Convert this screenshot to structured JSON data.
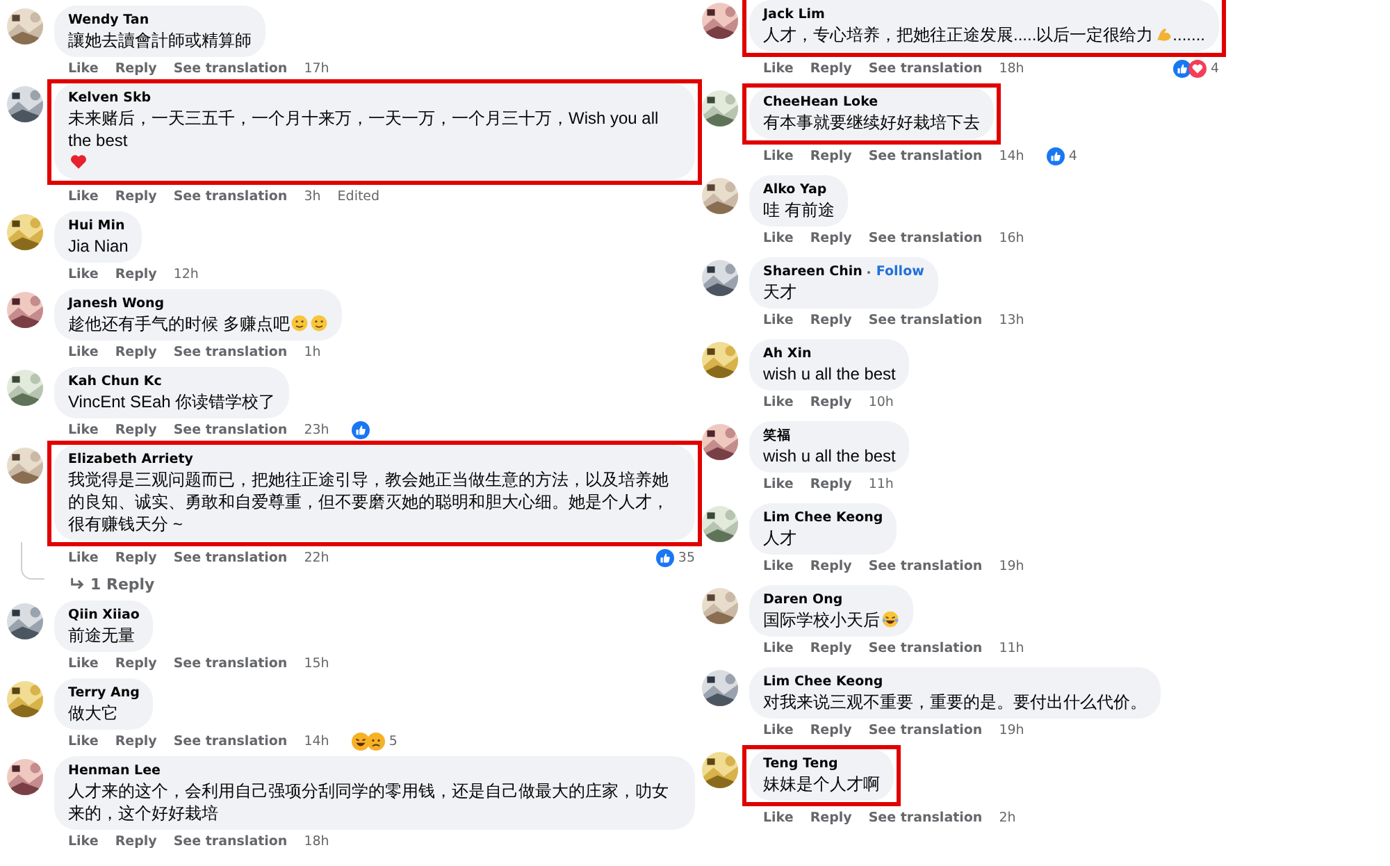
{
  "columns": [
    {
      "comments": [
        {
          "name": "Wendy Tan",
          "highlighted": false,
          "body": [
            {
              "kind": "text",
              "text": "讓她去讀會計師或精算師"
            }
          ],
          "actions": [
            "Like",
            "Reply",
            "See translation"
          ],
          "time": "17h"
        },
        {
          "name": "Kelven Skb",
          "highlighted": true,
          "body": [
            {
              "kind": "text",
              "text": "未来赌后，一天三五千，一个月十来万，一天一万，一个月三十万，Wish you all the best"
            },
            {
              "kind": "heart"
            }
          ],
          "actions": [
            "Like",
            "Reply",
            "See translation"
          ],
          "time": "3h",
          "edited": "Edited"
        },
        {
          "name": "Hui Min",
          "highlighted": false,
          "body": [
            {
              "kind": "text",
              "text": "Jia Nian"
            }
          ],
          "actions": [
            "Like",
            "Reply"
          ],
          "time": "12h"
        },
        {
          "name": "Janesh Wong",
          "highlighted": false,
          "body": [
            {
              "kind": "text",
              "text": "趁他还有手气的时候 多赚点吧"
            },
            {
              "kind": "face"
            },
            {
              "kind": "face"
            }
          ],
          "actions": [
            "Like",
            "Reply",
            "See translation"
          ],
          "time": "1h"
        },
        {
          "name": "Kah Chun Kc",
          "highlighted": false,
          "body": [
            {
              "kind": "text",
              "text": "VincEnt SEah 你读错学校了"
            }
          ],
          "actions": [
            "Like",
            "Reply",
            "See translation"
          ],
          "time": "23h",
          "reactions": {
            "icons": [
              {
                "kind": "like"
              }
            ]
          }
        },
        {
          "name": "Elizabeth Arriety",
          "highlighted": true,
          "body": [
            {
              "kind": "text",
              "text": "我觉得是三观问题而已，把她往正途引导，教会她正当做生意的方法，以及培养她的良知、诚实、勇敢和自爱尊重，但不要磨灭她的聪明和胆大心细。她是个人才，很有赚钱天分 ~"
            }
          ],
          "actions": [
            "Like",
            "Reply",
            "See translation"
          ],
          "time": "22h",
          "reactions": {
            "icons": [
              {
                "kind": "like"
              }
            ],
            "count": "35"
          },
          "replies": "1 Reply"
        },
        {
          "name": "Qiin Xiiao",
          "highlighted": false,
          "body": [
            {
              "kind": "text",
              "text": "前途无量"
            }
          ],
          "actions": [
            "Like",
            "Reply",
            "See translation"
          ],
          "time": "15h"
        },
        {
          "name": "Terry Ang",
          "highlighted": false,
          "body": [
            {
              "kind": "text",
              "text": "做大它"
            }
          ],
          "actions": [
            "Like",
            "Reply",
            "See translation"
          ],
          "time": "14h",
          "reactions": {
            "icons": [
              {
                "kind": "haha"
              },
              {
                "kind": "sad"
              }
            ],
            "count": "5"
          }
        },
        {
          "name": "Henman Lee",
          "highlighted": false,
          "body": [
            {
              "kind": "text",
              "text": "人才来的这个，会利用自己强项分刮同学的零用钱，还是自己做最大的庄家，叻女来的，这个好好栽培"
            }
          ],
          "actions": [
            "Like",
            "Reply",
            "See translation"
          ],
          "time": "18h"
        }
      ]
    },
    {
      "comments": [
        {
          "name": "Jack Lim",
          "highlighted": true,
          "body": [
            {
              "kind": "text",
              "text": "人才，专心培养，把她往正途发展.....以后一定很给力"
            },
            {
              "kind": "arm"
            },
            {
              "kind": "text",
              "text": "......."
            }
          ],
          "actions": [
            "Like",
            "Reply",
            "See translation"
          ],
          "time": "18h",
          "reactions": {
            "icons": [
              {
                "kind": "like"
              },
              {
                "kind": "love"
              }
            ],
            "count": "4"
          }
        },
        {
          "name": "CheeHean Loke",
          "highlighted": true,
          "body": [
            {
              "kind": "text",
              "text": "有本事就要继续好好栽培下去"
            }
          ],
          "actions": [
            "Like",
            "Reply",
            "See translation"
          ],
          "time": "14h",
          "reactions": {
            "icons": [
              {
                "kind": "like"
              }
            ],
            "count": "4"
          }
        },
        {
          "name": "Alko Yap",
          "highlighted": false,
          "body": [
            {
              "kind": "text",
              "text": "哇 有前途"
            }
          ],
          "actions": [
            "Like",
            "Reply",
            "See translation"
          ],
          "time": "16h"
        },
        {
          "name": "Shareen Chin",
          "follow": "Follow",
          "highlighted": false,
          "body": [
            {
              "kind": "text",
              "text": "天才"
            }
          ],
          "actions": [
            "Like",
            "Reply",
            "See translation"
          ],
          "time": "13h"
        },
        {
          "name": "Ah Xin",
          "highlighted": false,
          "body": [
            {
              "kind": "text",
              "text": "wish u all the best"
            }
          ],
          "actions": [
            "Like",
            "Reply"
          ],
          "time": "10h"
        },
        {
          "name": "笑福",
          "highlighted": false,
          "body": [
            {
              "kind": "text",
              "text": "wish u all the best"
            }
          ],
          "actions": [
            "Like",
            "Reply"
          ],
          "time": "11h"
        },
        {
          "name": "Lim Chee Keong",
          "highlighted": false,
          "body": [
            {
              "kind": "text",
              "text": "人才"
            }
          ],
          "actions": [
            "Like",
            "Reply",
            "See translation"
          ],
          "time": "19h"
        },
        {
          "name": "Daren Ong",
          "highlighted": false,
          "body": [
            {
              "kind": "text",
              "text": "国际学校小天后"
            },
            {
              "kind": "laugh"
            }
          ],
          "actions": [
            "Like",
            "Reply",
            "See translation"
          ],
          "time": "11h"
        },
        {
          "name": "Lim Chee Keong",
          "highlighted": false,
          "body": [
            {
              "kind": "text",
              "text": "对我来说三观不重要，重要的是。要付出什么代价。"
            }
          ],
          "actions": [
            "Like",
            "Reply",
            "See translation"
          ],
          "time": "19h"
        },
        {
          "name": "Teng Teng",
          "highlighted": true,
          "body": [
            {
              "kind": "text",
              "text": "妹妹是个人才啊"
            }
          ],
          "actions": [
            "Like",
            "Reply",
            "See translation"
          ],
          "time": "2h"
        }
      ]
    }
  ]
}
